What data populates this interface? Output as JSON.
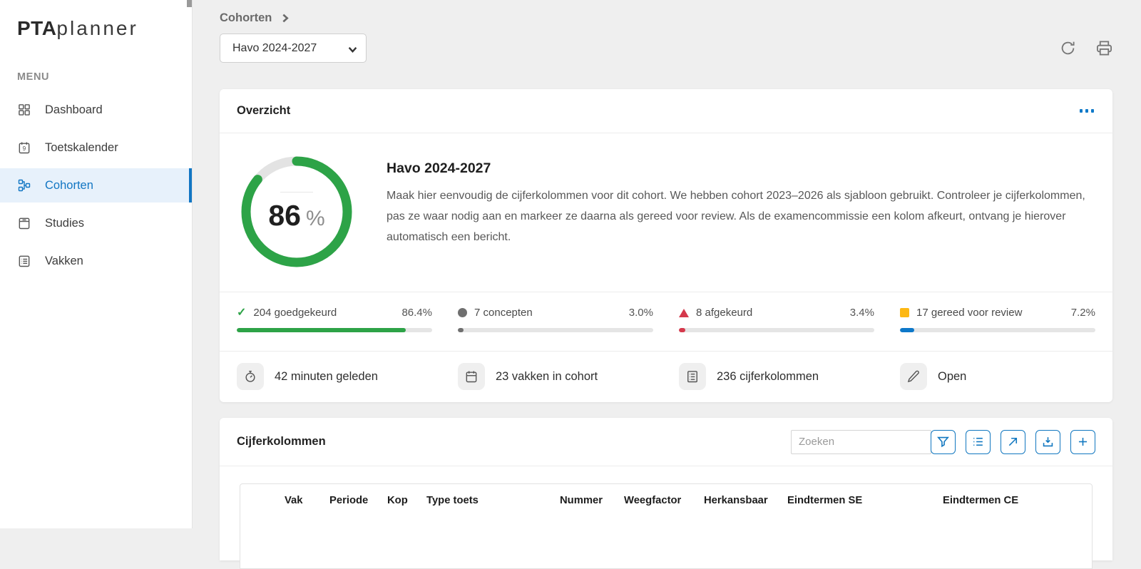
{
  "app": {
    "brand_bold": "PTA",
    "brand_light": "planner"
  },
  "colors": {
    "accent_blue": "#0f7ac9",
    "sidebar_active_blue": "#1276c3",
    "green": "#2da347",
    "gray_status": "#6f6f6f",
    "red": "#d5394c",
    "yellow": "#fdb813",
    "bar_blue": "#0d78c9"
  },
  "sidebar": {
    "menu_label": "MENU",
    "items": [
      {
        "label": "Dashboard",
        "icon": "grid-icon",
        "active": false
      },
      {
        "label": "Toetskalender",
        "icon": "calendar-9-icon",
        "active": false
      },
      {
        "label": "Cohorten",
        "icon": "sitemap-icon",
        "active": true
      },
      {
        "label": "Studies",
        "icon": "notebook-icon",
        "active": false
      },
      {
        "label": "Vakken",
        "icon": "list-box-icon",
        "active": false
      }
    ]
  },
  "header": {
    "breadcrumb": "Cohorten",
    "cohort_select": {
      "value": "Havo 2024-2027"
    },
    "actions": [
      "refresh-icon",
      "print-icon"
    ]
  },
  "overview_card": {
    "title": "Overzicht",
    "menu_icon": "ellipsis-icon",
    "donut": {
      "percent": 86,
      "suffix": "%",
      "color": "#2da347",
      "track_color": "#e3e3e3"
    },
    "cohort_title": "Havo 2024-2027",
    "description": "Maak hier eenvoudig de cijferkolommen voor dit cohort. We hebben cohort 2023–2026 als sjabloon gebruikt. Controleer je cijferkolommen, pas ze waar nodig aan en markeer ze daarna als gereed voor review. Als de examencommissie een kolom afkeurt, ontvang je hierover automatisch een bericht.",
    "statuses": [
      {
        "label": "204 goedgekeurd",
        "pct_label": "86.4%",
        "value": 86.4,
        "marker": "check",
        "marker_glyph": "✓",
        "marker_color": "#2da347",
        "bar_color": "#2da347"
      },
      {
        "label": "7 concepten",
        "pct_label": "3.0%",
        "value": 3.0,
        "marker": "circle",
        "marker_color": "#6f6f6f",
        "bar_color": "#6f6f6f"
      },
      {
        "label": "8 afgekeurd",
        "pct_label": "3.4%",
        "value": 3.4,
        "marker": "triangle",
        "marker_color": "#d5394c",
        "bar_color": "#d5394c"
      },
      {
        "label": "17 gereed voor review",
        "pct_label": "7.2%",
        "value": 7.2,
        "marker": "square",
        "marker_color": "#fdb813",
        "bar_color": "#0d78c9"
      }
    ],
    "meta": [
      {
        "icon": "stopwatch-icon",
        "label": "42 minuten geleden"
      },
      {
        "icon": "calendar-icon",
        "label": "23 vakken in cohort"
      },
      {
        "icon": "grid-list-icon",
        "label": "236 cijferkolommen"
      },
      {
        "icon": "pencil-icon",
        "label": "Open"
      }
    ]
  },
  "table_card": {
    "title": "Cijferkolommen",
    "search_placeholder": "Zoeken",
    "toolbar_icons": [
      "filter-icon",
      "list-icon",
      "open-external-icon",
      "download-icon",
      "add-icon"
    ],
    "columns": [
      "Vak",
      "Periode",
      "Kop",
      "Type toets",
      "Nummer",
      "Weegfactor",
      "Herkansbaar",
      "Eindtermen SE",
      "Eindtermen CE"
    ]
  }
}
